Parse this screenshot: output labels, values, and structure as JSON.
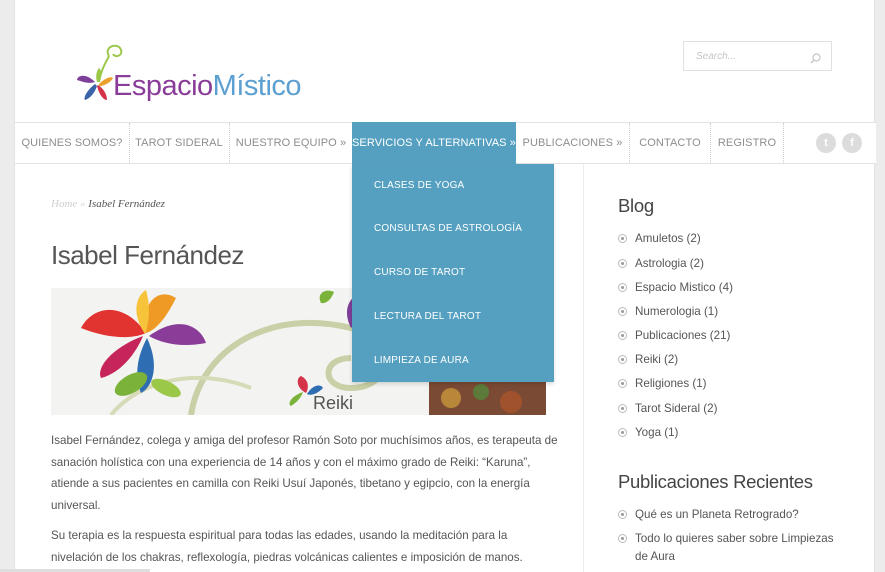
{
  "logo": {
    "word1": "Espacio",
    "word2": "Místico"
  },
  "search": {
    "placeholder": "Search..."
  },
  "nav": {
    "items": [
      {
        "label": "QUIENES SOMOS?"
      },
      {
        "label": "TAROT SIDERAL"
      },
      {
        "label": "NUESTRO EQUIPO »"
      },
      {
        "label": "SERVICIOS Y ALTERNATIVAS »"
      },
      {
        "label": "PUBLICACIONES »"
      },
      {
        "label": "CONTACTO"
      },
      {
        "label": "REGISTRO"
      }
    ],
    "social": [
      {
        "icon": "twitter-icon",
        "glyph": "t"
      },
      {
        "icon": "facebook-icon",
        "glyph": "f"
      }
    ]
  },
  "dropdown": {
    "items": [
      {
        "label": "CLASES DE YOGA"
      },
      {
        "label": "CONSULTAS DE ASTROLOGÍA"
      },
      {
        "label": "CURSO DE TAROT"
      },
      {
        "label": "LECTURA DEL TAROT"
      },
      {
        "label": "LIMPIEZA DE AURA"
      }
    ]
  },
  "breadcrumb": {
    "home": "Home",
    "sep": "»",
    "current": "Isabel Fernández"
  },
  "main": {
    "title": "Isabel Fernández",
    "banner_label": "Reiki",
    "paragraphs": [
      "Isabel Fernández, colega y amiga del profesor Ramón Soto por muchísimos años, es terapeuta de sanación holística con una experiencia de 14 años y con el máximo grado de Reiki: “Karuna”, atiende a sus pacientes en camilla con Reiki Usuí Japonés, tibetano y egipcio, con la energía universal.",
      "Su terapia es la respuesta espiritual para todas las edades, usando la meditación para la nivelación de los chakras, reflexología, piedras volcánicas calientes e imposición de manos."
    ]
  },
  "sidebar": {
    "blog_title": "Blog",
    "categories": [
      {
        "label": "Amuletos (2)"
      },
      {
        "label": "Astrologia (2)"
      },
      {
        "label": "Espacio Mistico (4)"
      },
      {
        "label": "Numerologia (1)"
      },
      {
        "label": "Publicaciones (21)"
      },
      {
        "label": "Reiki (2)"
      },
      {
        "label": "Religiones (1)"
      },
      {
        "label": "Tarot Sideral (2)"
      },
      {
        "label": "Yoga (1)"
      }
    ],
    "recent_title": "Publicaciones Recientes",
    "recent": [
      {
        "label": "Qué es un Planeta Retrogrado?"
      },
      {
        "label": "Todo lo quieres saber sobre Limpiezas de Aura"
      }
    ]
  },
  "colors": {
    "accent": "#55a0c0",
    "logo_purple": "#8a3d98",
    "logo_blue": "#5c9fd1"
  }
}
